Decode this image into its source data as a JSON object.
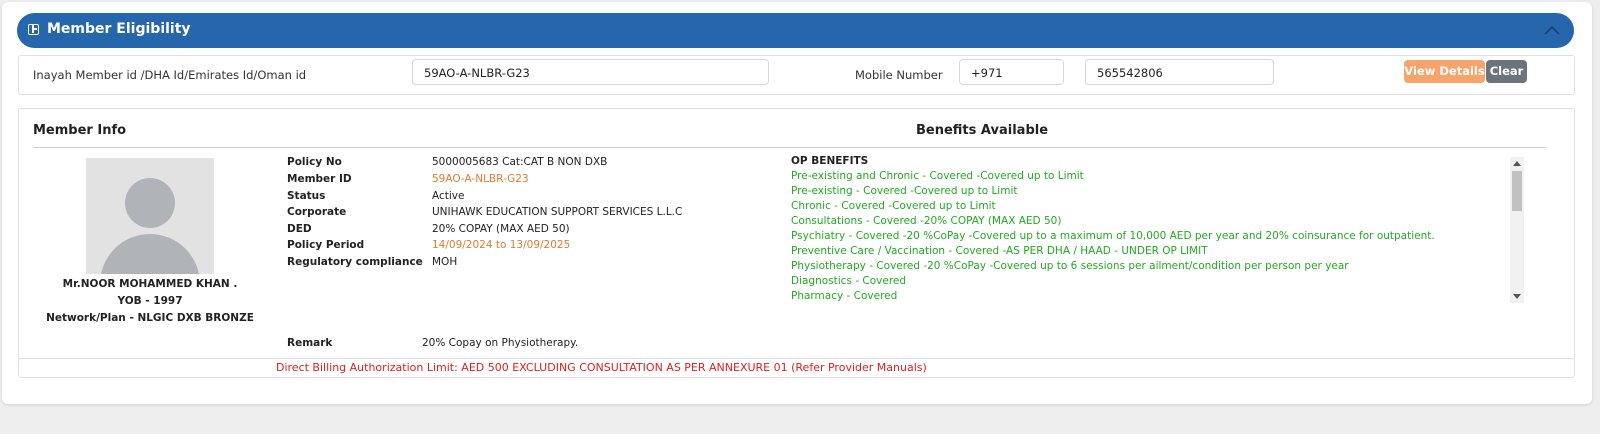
{
  "header": {
    "title": "Member Eligibility"
  },
  "search": {
    "member_id_label": "Inayah Member id /DHA Id/Emirates Id/Oman id",
    "member_id_value": "59AO-A-NLBR-G23",
    "mobile_label": "Mobile Number",
    "country_code": "+971",
    "mobile_value": "565542806",
    "view_details_label": "View Details",
    "clear_label": "Clear",
    "colors": {
      "view_details": "#f7a46b",
      "clear": "#6c737c",
      "header": "#2566ad"
    }
  },
  "member_info": {
    "title": "Member Info",
    "name": "Mr.NOOR MOHAMMED KHAN .",
    "yob": "YOB - 1997",
    "network": "Network/Plan - NLGIC DXB BRONZE",
    "fields": [
      {
        "label": "Policy No",
        "value": "5000005683 Cat:CAT B NON DXB"
      },
      {
        "label": "Member ID",
        "value": "59AO-A-NLBR-G23"
      },
      {
        "label": "Status",
        "value": "Active"
      },
      {
        "label": "Corporate",
        "value": "UNIHAWK EDUCATION SUPPORT SERVICES L.L.C"
      },
      {
        "label": "DED",
        "value": "20% COPAY (MAX AED 50)"
      },
      {
        "label": "Policy Period",
        "value": "14/09/2024 to 13/09/2025"
      },
      {
        "label": "Regulatory compliance",
        "value": "MOH"
      }
    ],
    "remark_label": "Remark",
    "remark_value": "20% Copay on Physiotherapy."
  },
  "benefits": {
    "title": "Benefits Available",
    "heading": "OP BENEFITS",
    "items": [
      "Pre-existing and Chronic - Covered -Covered up to Limit",
      "Pre-existing - Covered -Covered up to Limit",
      "Chronic - Covered -Covered up to Limit",
      "Consultations - Covered -20% COPAY (MAX AED 50)",
      "Psychiatry - Covered -20 %CoPay -Covered up to a maximum of 10,000 AED per year and 20% coinsurance for outpatient.",
      "Preventive Care / Vaccination - Covered -AS PER DHA / HAAD - UNDER OP LIMIT",
      "Physiotherapy - Covered -20 %CoPay -Covered up to 6 sessions per ailment/condition per person per year",
      "Diagnostics - Covered",
      "Pharmacy - Covered"
    ]
  },
  "footer": {
    "text": "Direct Billing Authorization Limit: AED 500 EXCLUDING CONSULTATION AS PER ANNEXURE 01 (Refer Provider Manuals)"
  }
}
